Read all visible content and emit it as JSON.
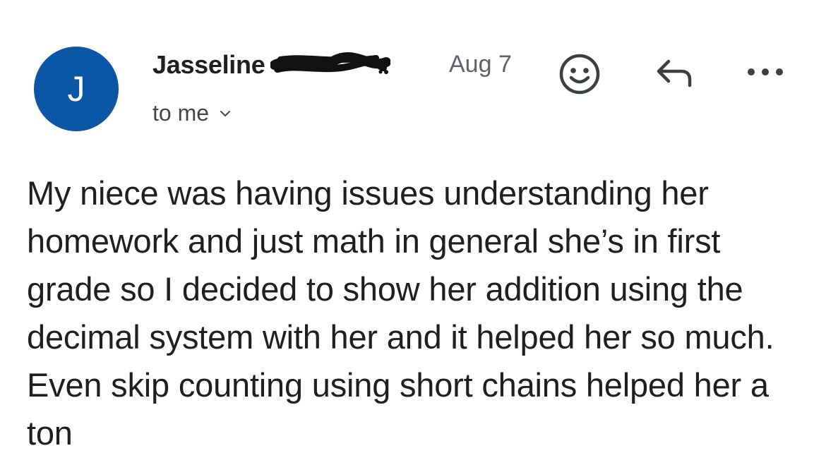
{
  "email": {
    "sender": {
      "avatar_initial": "J",
      "name_visible": "Jasseline",
      "name_redacted": true
    },
    "date": "Aug 7",
    "recipient_label": "to me",
    "body": "My niece was having issues understanding her homework and just math in general she’s in first grade so I decided to show her addition using the decimal system with her and it helped her so much. Even skip counting using short chains helped her a ton"
  },
  "actions": {
    "emoji_icon": "smiley-face-icon",
    "reply_icon": "reply-arrow-icon",
    "more_icon": "more-options-icon"
  },
  "colors": {
    "avatar_bg": "#0b57a5",
    "text_primary": "#1f1f1f",
    "text_secondary": "#5f6368"
  }
}
